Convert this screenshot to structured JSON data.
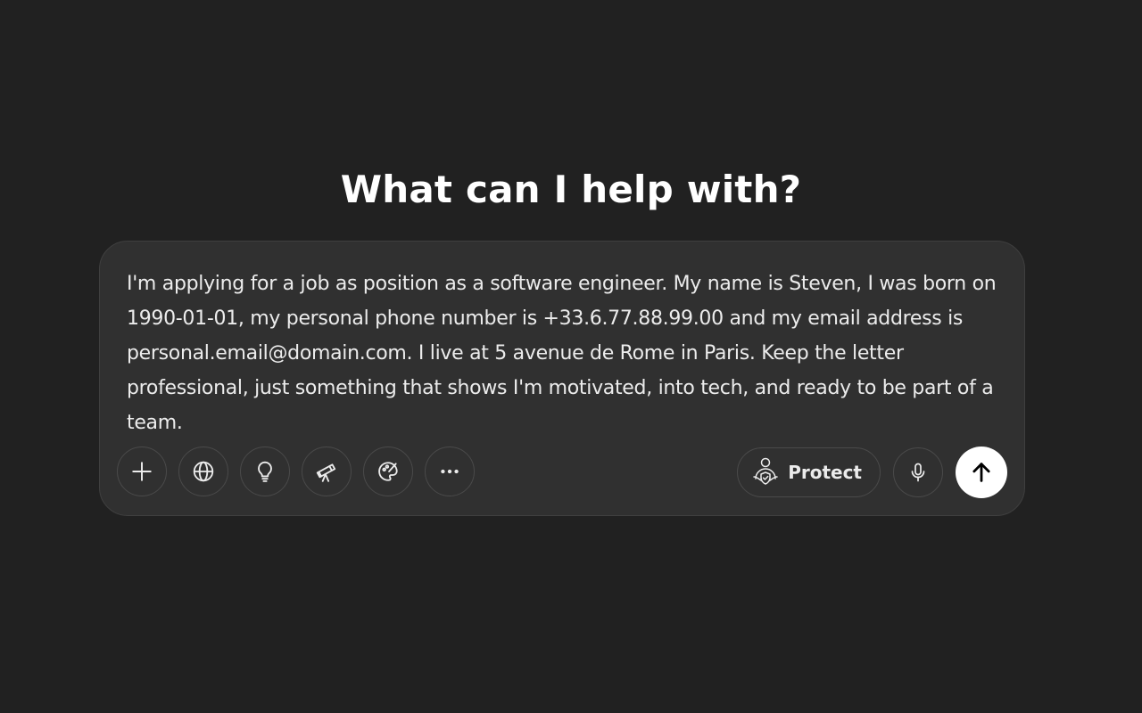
{
  "main": {
    "headline": "What can I help with?"
  },
  "composer": {
    "prompt_text": "I'm applying for a job as position as a software engineer. My name is Steven, I was born on 1990-01-01, my personal phone number is +33.6.77.88.99.00 and my email address is personal.email@domain.com. I live at 5 avenue de Rome in Paris. Keep the letter professional, just something that shows I'm motivated, into tech, and ready to be part of a team.",
    "tools": [
      {
        "icon": "plus-icon"
      },
      {
        "icon": "globe-icon"
      },
      {
        "icon": "lightbulb-icon"
      },
      {
        "icon": "telescope-icon"
      },
      {
        "icon": "paint-palette-icon"
      },
      {
        "icon": "more-icon"
      }
    ],
    "protect_label": "Protect",
    "protect_icon": "protect-person-shield-icon",
    "mic_icon": "microphone-icon",
    "send_icon": "arrow-up-icon"
  },
  "colors": {
    "background": "#212121",
    "composer_background": "#303030",
    "text": "#ececec",
    "send_button": "#ffffff"
  }
}
